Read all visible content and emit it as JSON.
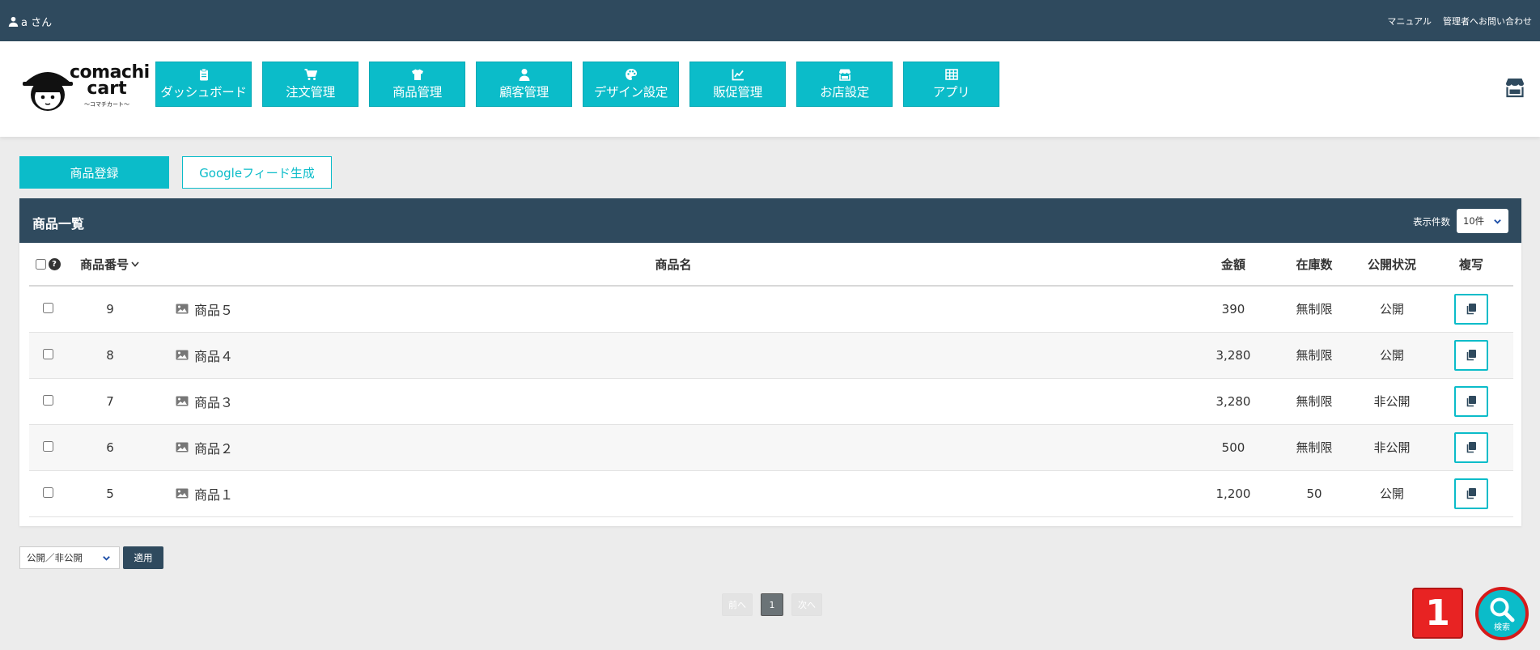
{
  "topbar": {
    "user_label": "a さん",
    "links": [
      "マニュアル",
      "管理者へお問い合わせ"
    ]
  },
  "logo": {
    "line1": "comachi",
    "line2": "cart",
    "sub": "〜コマチカート〜"
  },
  "nav": [
    {
      "label": "ダッシュボード",
      "icon": "clipboard-icon"
    },
    {
      "label": "注文管理",
      "icon": "cart-icon"
    },
    {
      "label": "商品管理",
      "icon": "shirt-icon"
    },
    {
      "label": "顧客管理",
      "icon": "user-icon"
    },
    {
      "label": "デザイン設定",
      "icon": "palette-icon"
    },
    {
      "label": "販促管理",
      "icon": "chart-line-icon"
    },
    {
      "label": "お店設定",
      "icon": "store-icon"
    },
    {
      "label": "アプリ",
      "icon": "grid-icon"
    }
  ],
  "actions": {
    "register_label": "商品登録",
    "feed_label": "Googleフィード生成"
  },
  "list": {
    "title": "商品一覧",
    "per_page_label": "表示件数",
    "per_page_value": "10件",
    "headers": {
      "number": "商品番号",
      "name": "商品名",
      "price": "金額",
      "stock": "在庫数",
      "status": "公開状況",
      "copy": "複写"
    },
    "rows": [
      {
        "number": "9",
        "name": "商品５",
        "price": "390",
        "stock": "無制限",
        "status": "公開"
      },
      {
        "number": "8",
        "name": "商品４",
        "price": "3,280",
        "stock": "無制限",
        "status": "公開"
      },
      {
        "number": "7",
        "name": "商品３",
        "price": "3,280",
        "stock": "無制限",
        "status": "非公開"
      },
      {
        "number": "6",
        "name": "商品２",
        "price": "500",
        "stock": "無制限",
        "status": "非公開"
      },
      {
        "number": "5",
        "name": "商品１",
        "price": "1,200",
        "stock": "50",
        "status": "公開"
      }
    ]
  },
  "bulk": {
    "select_value": "公開／非公開",
    "apply_label": "適用"
  },
  "pager": {
    "prev": "前へ",
    "current": "1",
    "next": "次へ"
  },
  "badge": "1",
  "search_fab_label": "検索",
  "colors": {
    "accent": "#0bbcc9",
    "dark": "#2f4a5e",
    "alert": "#e82323"
  }
}
